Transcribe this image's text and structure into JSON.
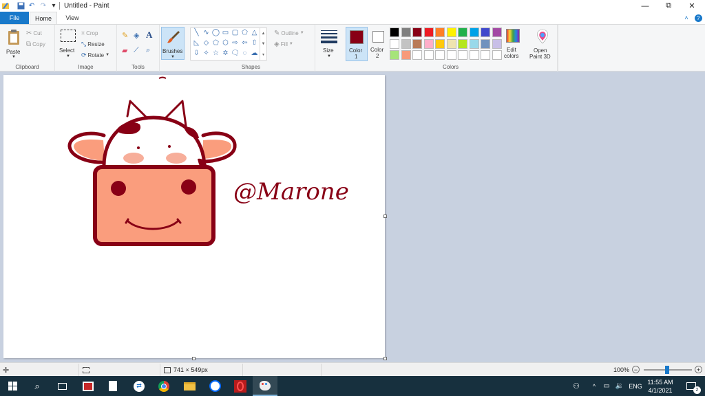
{
  "window": {
    "title": "Untitled - Paint",
    "minimize_glyph": "—",
    "maximize_glyph": "⧉",
    "close_glyph": "✕"
  },
  "quick_access": {
    "dropdown_glyph": "▾"
  },
  "tabs": [
    {
      "label": "File"
    },
    {
      "label": "Home"
    },
    {
      "label": "View"
    }
  ],
  "help": {
    "collapse_glyph": "˄",
    "help_glyph": "?"
  },
  "ribbon": {
    "clipboard": {
      "label": "Clipboard",
      "paste": "Paste",
      "cut": "Cut",
      "copy": "Copy"
    },
    "image": {
      "label": "Image",
      "select": "Select",
      "crop": "Crop",
      "resize": "Resize",
      "rotate": "Rotate"
    },
    "tools": {
      "label": "Tools"
    },
    "brushes": {
      "label": "Brushes"
    },
    "shapes": {
      "label": "Shapes",
      "outline": "Outline",
      "fill": "Fill"
    },
    "size": {
      "label": "Size"
    },
    "colors": {
      "label": "Colors",
      "color1_label": "Color",
      "color1_num": "1",
      "color2_label": "Color",
      "color2_num": "2",
      "color1_value": "#880015",
      "color2_value": "#ffffff",
      "edit_label": "Edit",
      "edit_label2": "colors",
      "palette_row1": [
        "#000000",
        "#7f7f7f",
        "#880015",
        "#ed1c24",
        "#ff7f27",
        "#fff200",
        "#22b14c",
        "#00a2e8",
        "#3f48cc",
        "#a349a4"
      ],
      "palette_row2": [
        "#ffffff",
        "#c3c3c3",
        "#b97a57",
        "#ffaec9",
        "#ffc90e",
        "#efe4b0",
        "#b5e61d",
        "#99d9ea",
        "#7092be",
        "#c8bfe7"
      ],
      "palette_row3": [
        "#a6e47a",
        "#f79a7a",
        "#ffffff",
        "#ffffff",
        "#ffffff",
        "#ffffff",
        "#ffffff",
        "#ffffff",
        "#ffffff",
        "#ffffff"
      ]
    },
    "paint3d": {
      "label": "Open",
      "label2": "Paint 3D"
    }
  },
  "canvas": {
    "signature": "@Marone",
    "ink_color": "#880015",
    "face_fill": "#fa9d7d",
    "blush_fill": "#f7ae9a"
  },
  "status": {
    "dimensions": "741 × 549px",
    "zoom": "100%",
    "zoom_minus": "−",
    "zoom_plus": "+"
  },
  "taskbar": {
    "language": "ENG",
    "time": "11:55 AM",
    "date": "4/1/2021",
    "notifications": "2",
    "tray_chevron": "^"
  }
}
